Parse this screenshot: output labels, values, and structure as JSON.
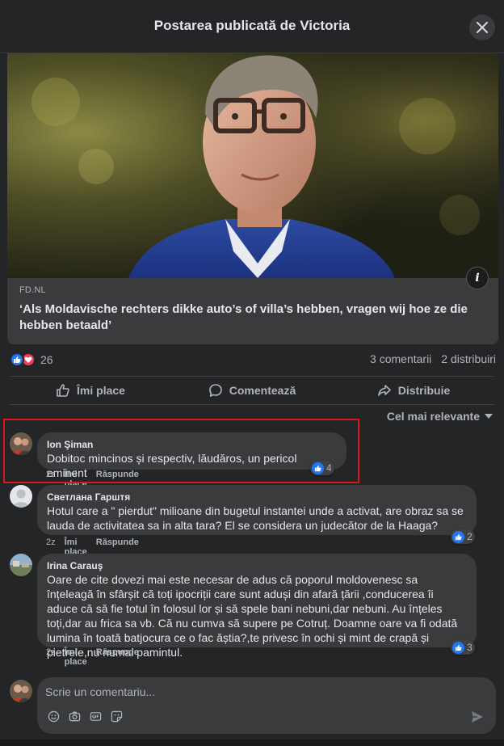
{
  "header": {
    "title": "Postarea publicată de Victoria",
    "close_icon": "close-icon"
  },
  "link_card": {
    "source": "FD.NL",
    "title": "‘Als Moldavische rechters dikke auto’s of villa’s hebben, vragen wij hoe ze die hebben betaald’",
    "info_icon": "info-icon"
  },
  "stats": {
    "reaction_count": "26",
    "comments": "3 comentarii",
    "shares": "2 distribuiri"
  },
  "actions": {
    "like": "Îmi place",
    "comment": "Comentează",
    "share": "Distribuie"
  },
  "sort": {
    "label": "Cel mai relevante"
  },
  "comments": [
    {
      "author": "Ion Şiman",
      "text": "Dobitoc mincinos și respectiv, lăudăros, un pericol eminent",
      "time": "2z",
      "like": "Îmi place",
      "reply": "Răspunde",
      "reactions": "4"
    },
    {
      "author": "Светлана Гарштя",
      "text": "Hotul care a \" pierdut\" milioane din bugetul instantei unde a activat, are obraz sa se lauda de activitatea sa in alta tara? El se considera un judecător de la Haaga?",
      "time": "2z",
      "like": "Îmi place",
      "reply": "Răspunde",
      "reactions": "2"
    },
    {
      "author": "Irina Carauş",
      "text": "Oare de cite dovezi mai este necesar de adus că poporul moldovenesc sa înțeleagă în sfârșit că toți ipocriții care sunt aduși din afară țării ,conducerea îi aduce că să fie totul în folosul lor și să spele bani nebuni,dar nebuni. Au înțeles toți,dar au frica sa vb. Că nu cumva să supere pe Cotruț. Doamne oare va fi odată lumina în toată batjocura ce o fac ăștia?,te privesc în ochi și mint de crapă și pietrele,nu numai pamintul.",
      "time": "2z",
      "like": "Îmi place",
      "reply": "Răspunde",
      "reactions": "3"
    }
  ],
  "composer": {
    "placeholder": "Scrie un comentariu..."
  },
  "colors": {
    "background": "#242526",
    "bubble": "#3a3b3c",
    "like_blue": "#2078f4",
    "love_red": "#f33e58",
    "highlight": "#e0151b"
  }
}
